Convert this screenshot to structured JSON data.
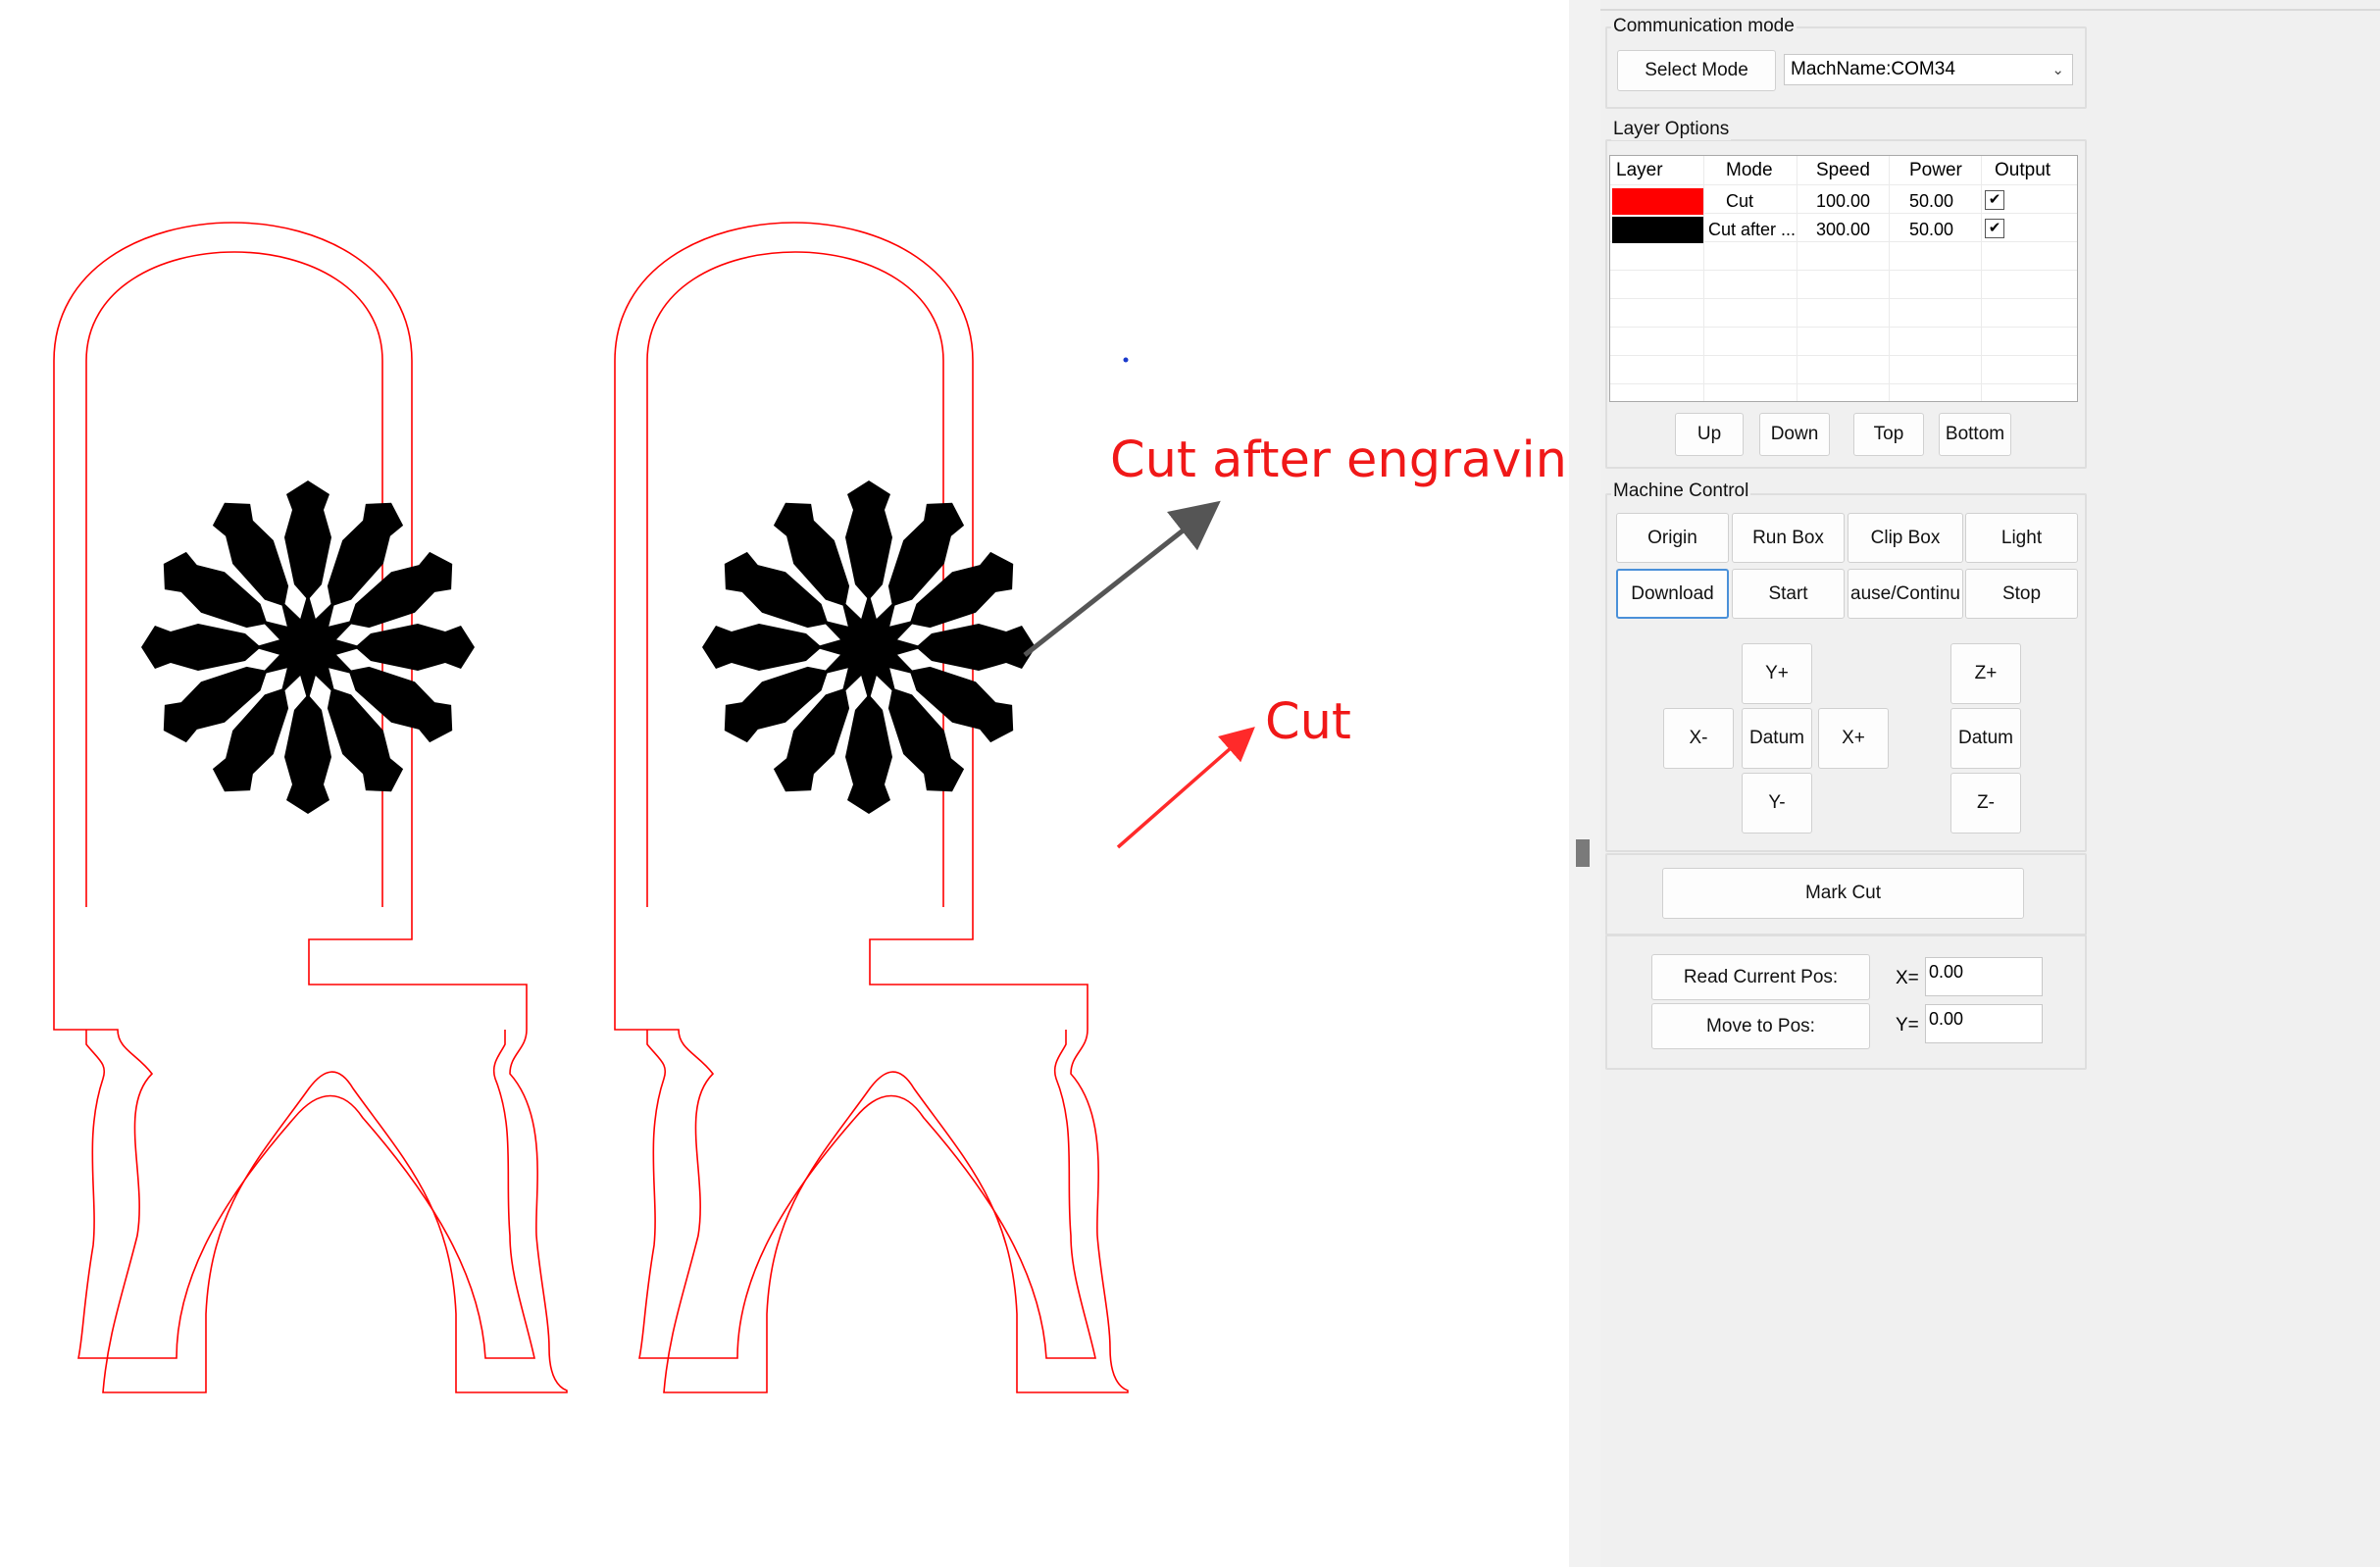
{
  "canvas": {
    "annotations": {
      "cut_after_engraving": "Cut after engraving",
      "cut": "Cut"
    },
    "colors": {
      "cut_line": "#ff0000",
      "engrave_fill": "#000000",
      "arrow_gray": "#555555",
      "arrow_red": "#ff2a2a",
      "annotation_text": "#f01818"
    }
  },
  "panel": {
    "communication": {
      "title": "Communication mode",
      "select_mode_label": "Select Mode",
      "machine_value": "MachName:COM34"
    },
    "layer_options": {
      "title": "Layer Options",
      "headers": [
        "Layer",
        "Mode",
        "Speed",
        "Power",
        "Output"
      ],
      "rows": [
        {
          "color": "#ff0000",
          "mode": "Cut",
          "speed": "100.00",
          "power": "50.00",
          "output": true
        },
        {
          "color": "#000000",
          "mode": "Cut after ...",
          "speed": "300.00",
          "power": "50.00",
          "output": true
        }
      ],
      "buttons": {
        "up": "Up",
        "down": "Down",
        "top": "Top",
        "bottom": "Bottom"
      }
    },
    "machine_control": {
      "title": "Machine Control",
      "buttons": {
        "origin": "Origin",
        "run_box": "Run Box",
        "clip_box": "Clip Box",
        "light": "Light",
        "download": "Download",
        "start": "Start",
        "pause": "ause/Continu",
        "stop": "Stop"
      },
      "jog": {
        "y_plus": "Y+",
        "y_minus": "Y-",
        "x_minus": "X-",
        "x_plus": "X+",
        "datum_xy": "Datum",
        "z_plus": "Z+",
        "z_minus": "Z-",
        "datum_z": "Datum"
      }
    },
    "mark_cut_label": "Mark Cut",
    "position": {
      "read_label": "Read Current Pos:",
      "move_label": "Move to Pos:",
      "x_label": "X=",
      "y_label": "Y=",
      "x_value": "0.00",
      "y_value": "0.00"
    }
  }
}
